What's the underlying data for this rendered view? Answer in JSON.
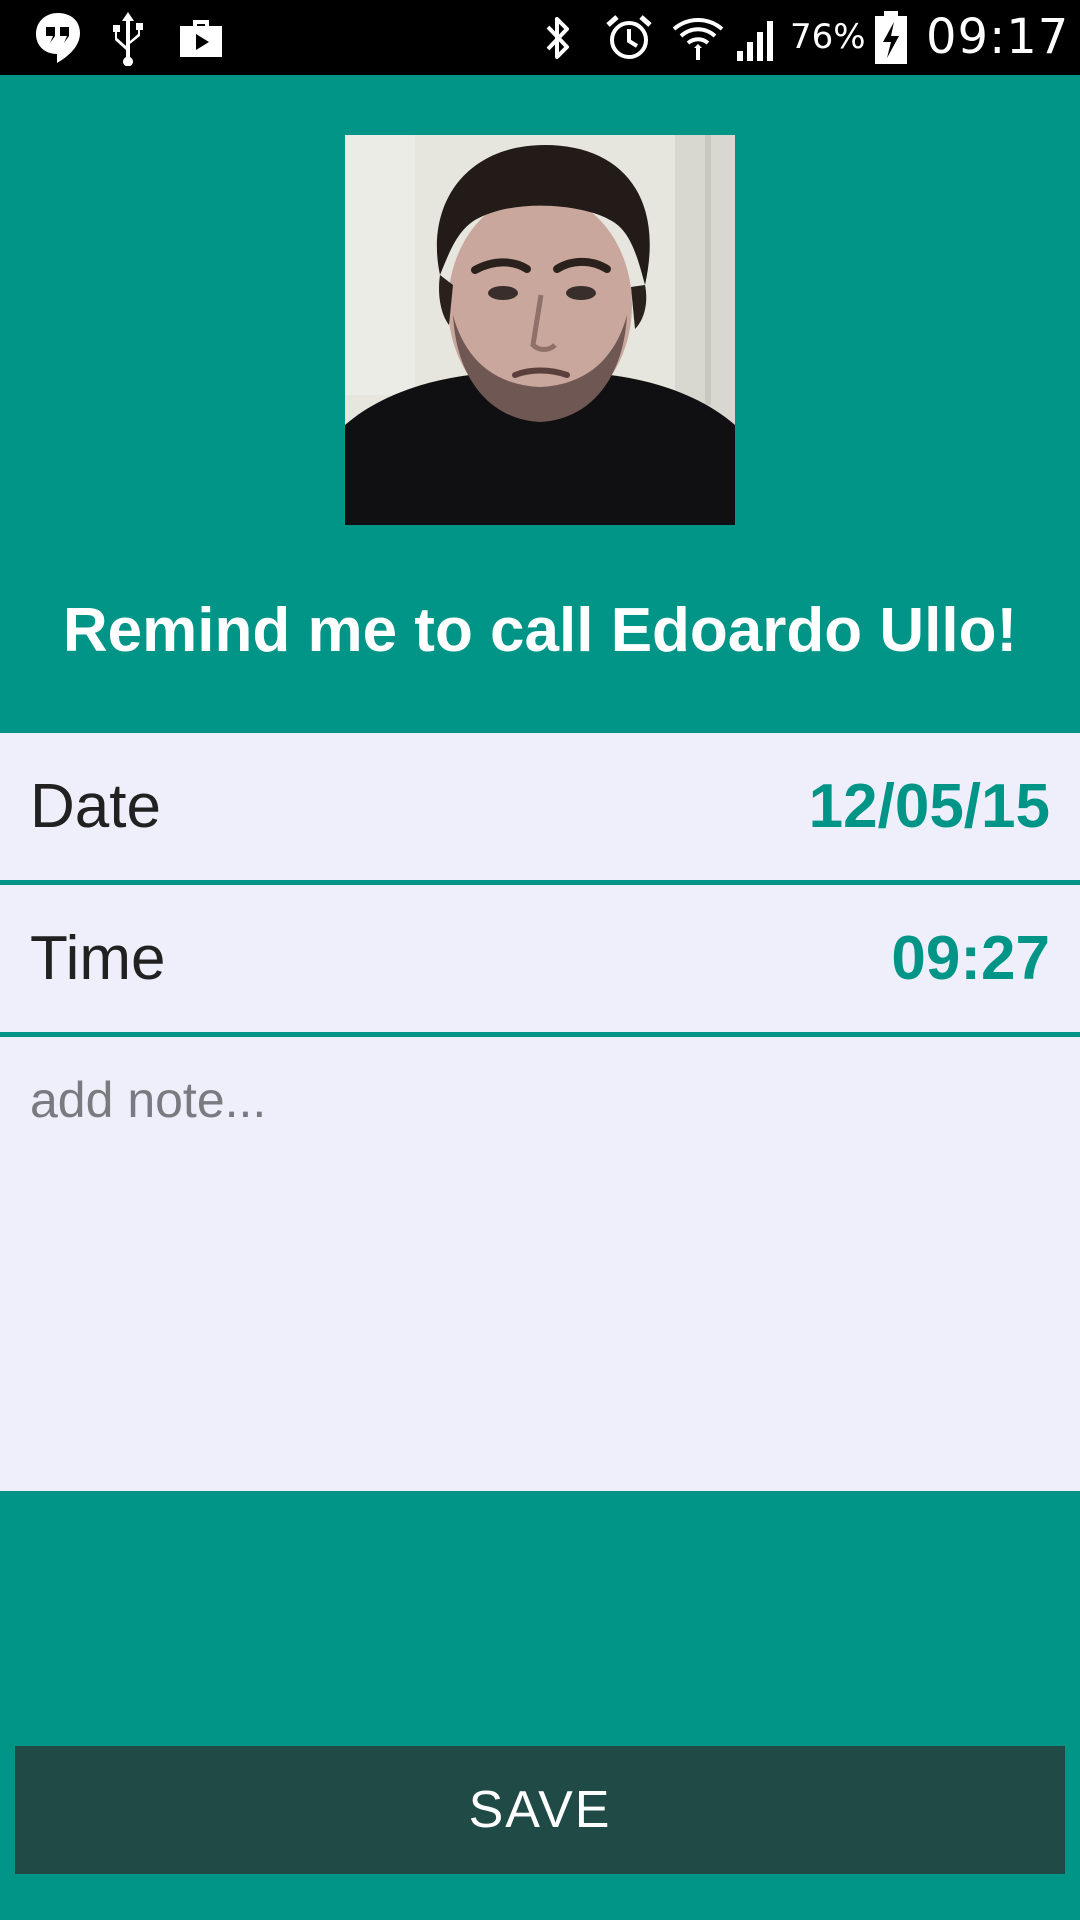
{
  "status_bar": {
    "left_icons": [
      "hangouts-icon",
      "usb-icon",
      "briefcase-icon"
    ],
    "right_icons": [
      "bluetooth-icon",
      "alarm-icon",
      "wifi-icon",
      "signal-icon",
      "battery-charging-icon"
    ],
    "battery_percent": "76%",
    "time": "09:17"
  },
  "header": {
    "photo_icon": "contact-photo",
    "title": "Remind me to call Edoardo Ullo!"
  },
  "form": {
    "date_label": "Date",
    "date_value": "12/05/15",
    "time_label": "Time",
    "time_value": "09:27",
    "note_placeholder": "add note...",
    "note_value": ""
  },
  "actions": {
    "save_label": "SAVE"
  },
  "colors": {
    "primary": "#009587",
    "panel": "#efeffb",
    "button": "#1f4a45",
    "status_bar": "#000000"
  }
}
